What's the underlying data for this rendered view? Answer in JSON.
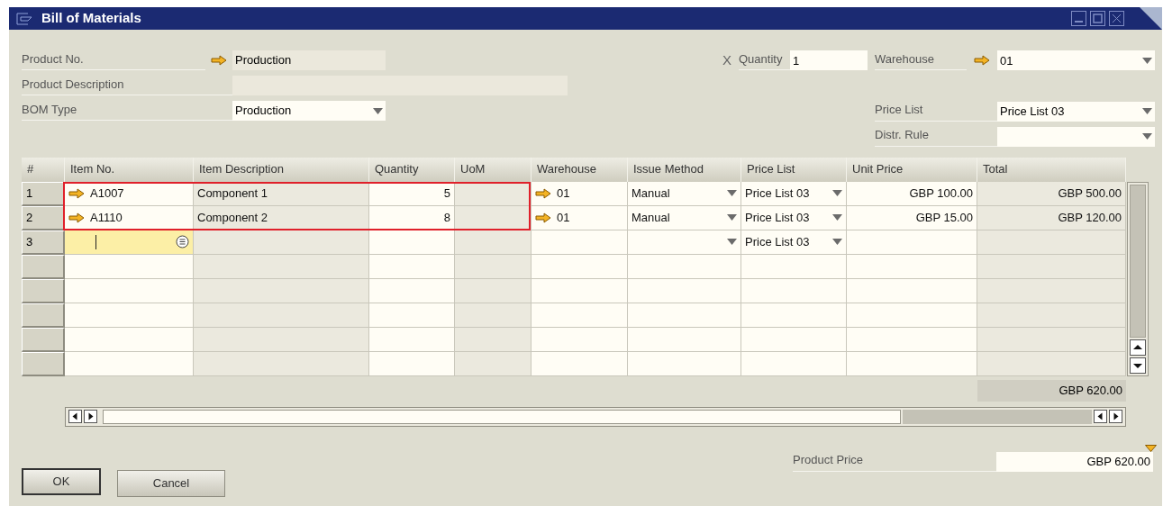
{
  "window": {
    "title": "Bill of Materials"
  },
  "header": {
    "product_no": {
      "label": "Product No.",
      "value": "Production"
    },
    "product_description": {
      "label": "Product Description"
    },
    "bom_type": {
      "label": "BOM Type",
      "value": "Production"
    },
    "quantity_marker": "X",
    "quantity": {
      "label": "Quantity",
      "value": "1"
    },
    "warehouse": {
      "label": "Warehouse",
      "value": "01"
    },
    "price_list": {
      "label": "Price List",
      "value": "Price List 03"
    },
    "distr_rule": {
      "label": "Distr. Rule"
    }
  },
  "table": {
    "columns": [
      "#",
      "Item No.",
      "Item Description",
      "Quantity",
      "UoM",
      "Warehouse",
      "Issue Method",
      "Price List",
      "Unit Price",
      "Total"
    ],
    "rows": [
      {
        "kind": "item",
        "highlighted": true,
        "num": "1",
        "item_no": "A1007",
        "item_description": "Component 1",
        "quantity": "5",
        "warehouse": "01",
        "issue_method": "Manual",
        "price_list": "Price List 03",
        "unit_price": "GBP 100.00",
        "total": "GBP 500.00"
      },
      {
        "kind": "item",
        "highlighted": true,
        "num": "2",
        "item_no": "A1110",
        "item_description": "Component 2",
        "quantity": "8",
        "warehouse": "01",
        "issue_method": "Manual",
        "price_list": "Price List 03",
        "unit_price": "GBP 15.00",
        "total": "GBP 120.00"
      },
      {
        "kind": "new",
        "highlighted": false,
        "num": "3",
        "price_list": "Price List 03"
      },
      {
        "kind": "blank",
        "highlighted": false
      },
      {
        "kind": "blank",
        "highlighted": false
      },
      {
        "kind": "blank",
        "highlighted": false
      },
      {
        "kind": "blank",
        "highlighted": false
      },
      {
        "kind": "blank",
        "highlighted": false
      }
    ],
    "column_total": "GBP 620.00"
  },
  "product_price": {
    "label": "Product Price",
    "value": "GBP 620.00"
  },
  "buttons": [
    {
      "label": "OK",
      "default": true
    },
    {
      "label": "Cancel",
      "default": false
    }
  ]
}
